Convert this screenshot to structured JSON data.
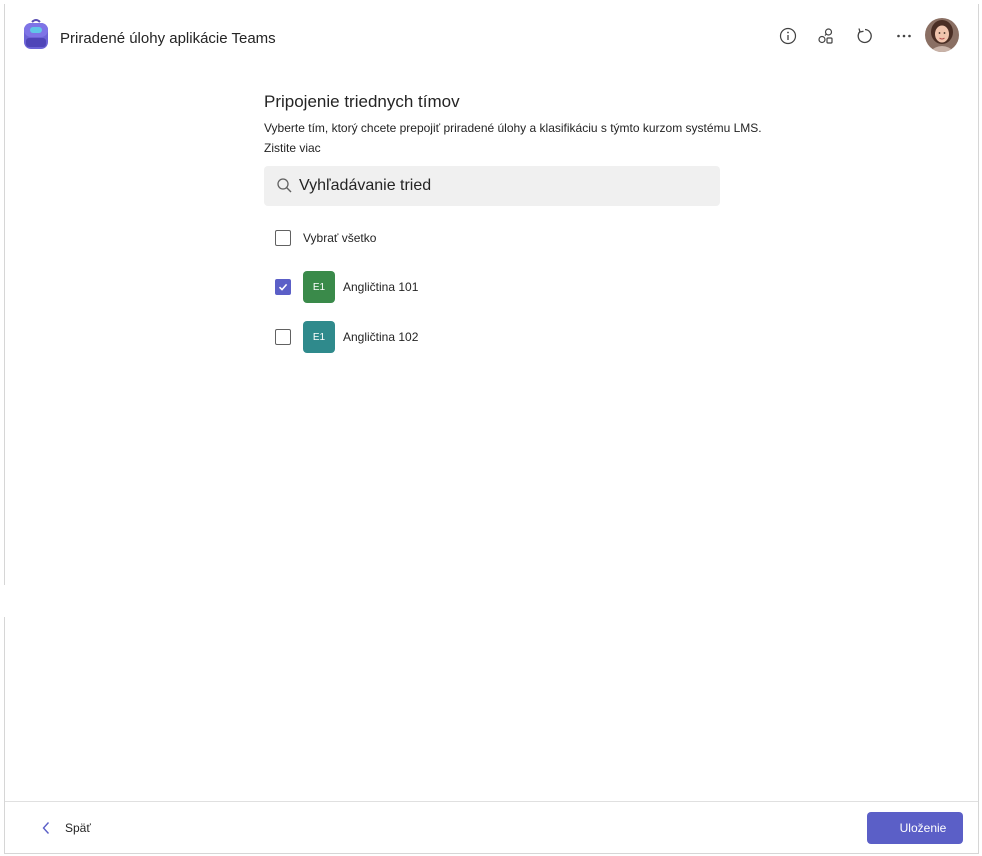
{
  "app": {
    "title": "Priradené úlohy aplikácie Teams",
    "icon": "backpack-icon"
  },
  "header_actions": [
    {
      "name": "info-icon"
    },
    {
      "name": "share-link-icon"
    },
    {
      "name": "refresh-icon"
    },
    {
      "name": "more-options-icon"
    }
  ],
  "main": {
    "title": "Pripojenie triednych tímov",
    "description": "Vyberte tím, ktorý chcete prepojiť priradené úlohy a klasifikáciu s týmto kurzom systému LMS.",
    "learn_more": "Zistite viac"
  },
  "search": {
    "placeholder": "Vyhľadávanie tried"
  },
  "select_all": {
    "label": "Vybrať všetko",
    "checked": false
  },
  "teams": [
    {
      "initials": "E1",
      "name": "Angličtina 101",
      "checked": true,
      "color": "#3a8a4a"
    },
    {
      "initials": "E1",
      "name": "Angličtina 102",
      "checked": false,
      "color": "#2f8a8c"
    }
  ],
  "footer": {
    "back_label": "Späť",
    "save_label": "Uloženie"
  },
  "colors": {
    "accent": "#5b5fc7"
  }
}
